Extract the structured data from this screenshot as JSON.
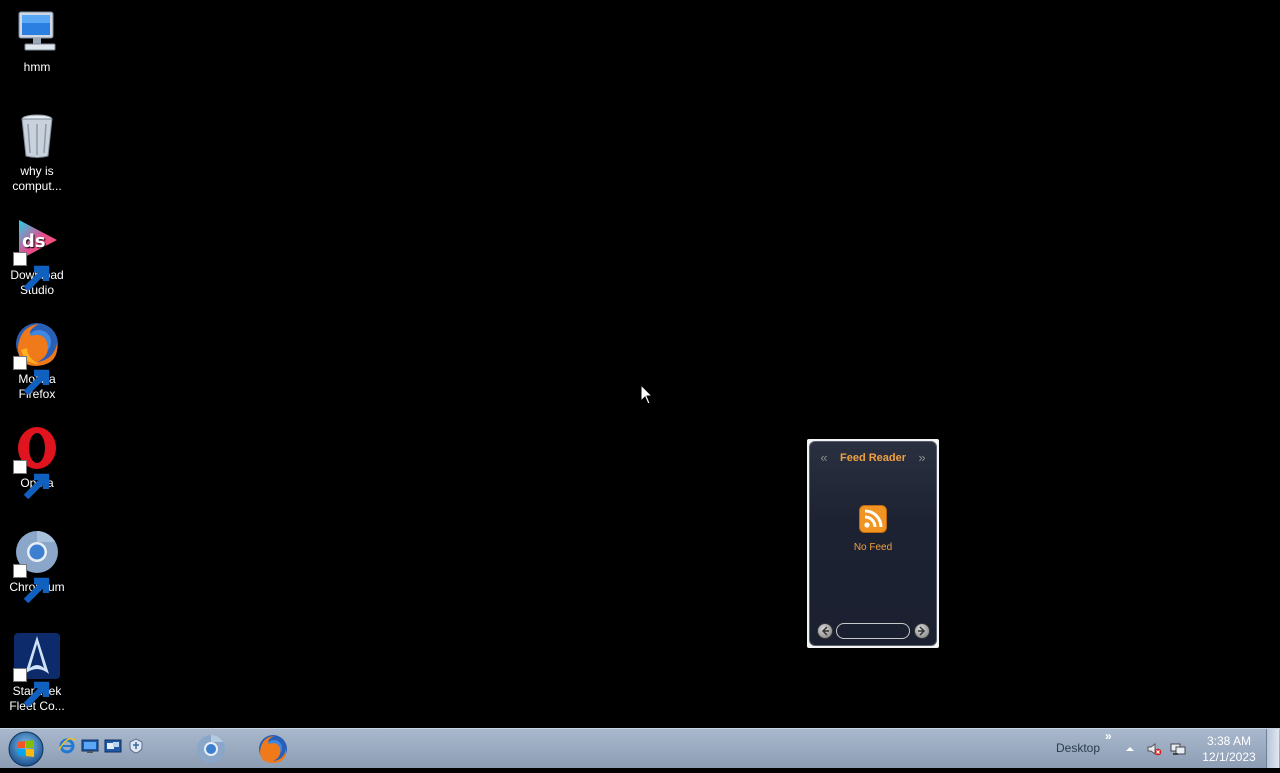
{
  "desktop_icons": [
    {
      "name": "hmm",
      "lines": [
        "hmm"
      ],
      "icon": "computer-icon",
      "shortcut": false
    },
    {
      "name": "recycle-bin",
      "lines": [
        "why is",
        "comput..."
      ],
      "icon": "recycle-bin-icon",
      "shortcut": false
    },
    {
      "name": "download-studio",
      "lines": [
        "Download",
        "Studio"
      ],
      "icon": "download-studio-icon",
      "shortcut": true
    },
    {
      "name": "mozilla-firefox",
      "lines": [
        "Mozilla",
        "Firefox"
      ],
      "icon": "firefox-icon",
      "shortcut": true
    },
    {
      "name": "opera",
      "lines": [
        "Opera"
      ],
      "icon": "opera-icon",
      "shortcut": true
    },
    {
      "name": "chromium",
      "lines": [
        "Chromium"
      ],
      "icon": "chromium-icon",
      "shortcut": true
    },
    {
      "name": "star-trek",
      "lines": [
        "Star Trek",
        "Fleet Co..."
      ],
      "icon": "star-trek-icon",
      "shortcut": true
    }
  ],
  "gadget": {
    "title": "Feed Reader",
    "prev_symbol": "«",
    "next_symbol": "»",
    "status": "No Feed",
    "accent": "#f0a040"
  },
  "taskbar": {
    "desktop_label": "Desktop",
    "desktop_chevron": "»",
    "quick_launch": [
      "internet-explorer-icon",
      "show-desktop-icon",
      "switch-windows-icon",
      "network-icon"
    ],
    "pinned_apps": [
      "chromium-icon",
      "firefox-icon"
    ],
    "tray": [
      "show-hidden-icons-icon",
      "volume-muted-icon",
      "network-status-icon"
    ],
    "clock": {
      "time": "3:38 AM",
      "date": "12/1/2023"
    }
  }
}
